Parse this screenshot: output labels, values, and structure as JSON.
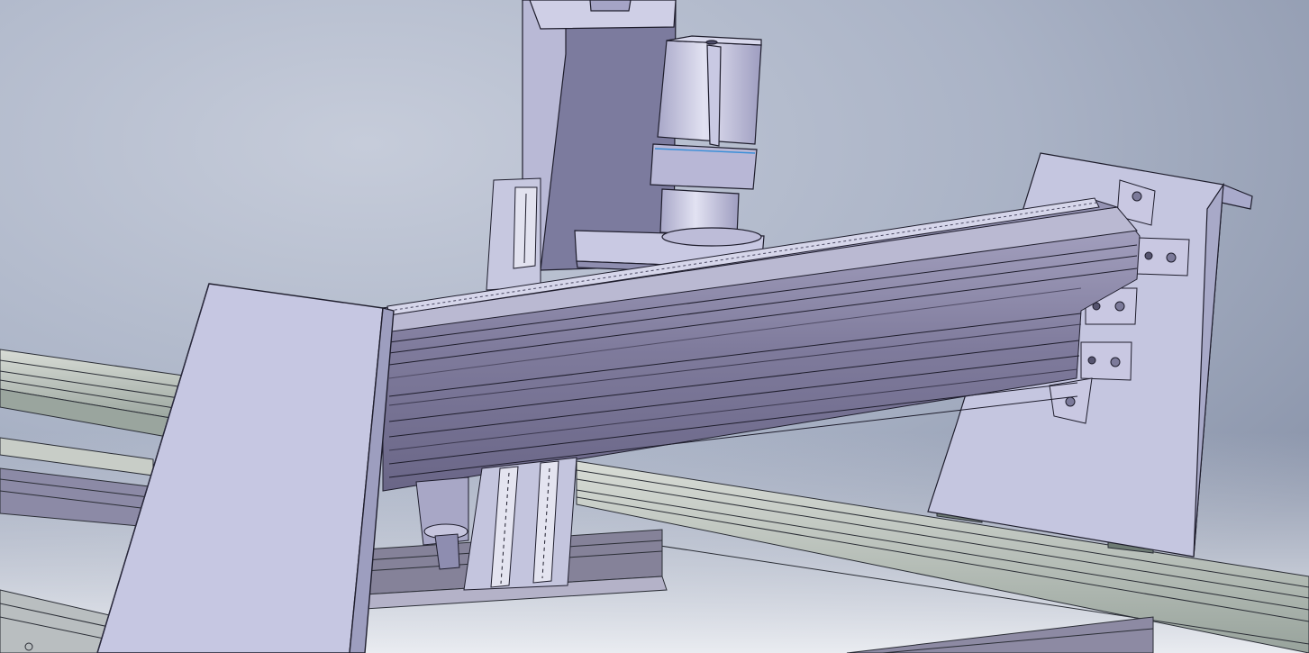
{
  "viewport": {
    "kind": "cad-3d-model-view",
    "background": {
      "top_left": "#c3c9d6",
      "center": "#b7bfcf",
      "right": "#8d97ad",
      "bottom": "#dfe2ea"
    }
  },
  "model": {
    "parts": [
      "base-frame-extrusion",
      "gantry-side-plate-left",
      "gantry-side-plate-right",
      "gantry-beam-extrusion",
      "x-linear-rail",
      "y-linear-rail",
      "z-axis-column",
      "z-linear-rail",
      "stepper-motor",
      "motor-mount-plate",
      "corner-brackets",
      "spindle"
    ],
    "colors": {
      "sheet_metal": "#c8c9e2",
      "sheet_metal_shadow": "#9c9dbd",
      "extrusion_face": "#8c89a8",
      "extrusion_dark": "#5e5a75",
      "extrusion_light": "#b4b3cc",
      "frame_rail_light": "#cfd4cf",
      "frame_rail_dark": "#8e9a92",
      "motor_body": "#b9b8d6",
      "motor_highlight": "#e6e6f3",
      "edge_line": "#1e1d2c",
      "accent_line": "#3a8fd8"
    }
  }
}
